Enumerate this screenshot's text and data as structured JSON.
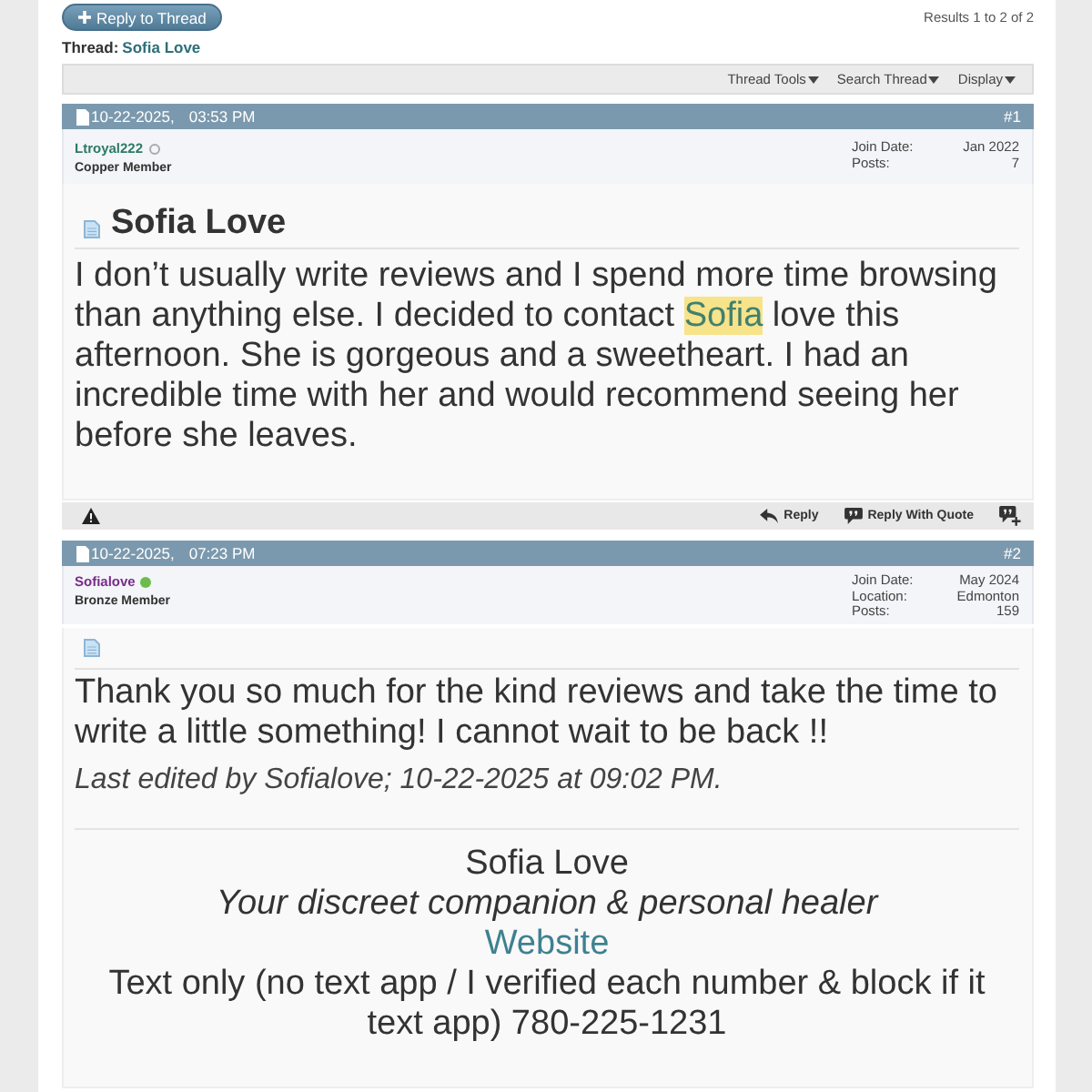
{
  "top_bar": {
    "reply_button": "Reply to Thread",
    "results": "Results 1 to 2 of 2"
  },
  "thread": {
    "label": "Thread:",
    "title": "Sofia Love"
  },
  "toolbar": {
    "menus": [
      "Thread Tools",
      "Search Thread",
      "Display"
    ]
  },
  "posts": [
    {
      "date": "10-22-2025,",
      "time": "03:53 PM",
      "number": "#1",
      "user": {
        "name": "Ltroyal222",
        "color": "#2e7a68",
        "online": false,
        "rank": "Copper Member",
        "details": [
          {
            "label": "Join Date:",
            "value": "Jan 2022"
          },
          {
            "label": "Posts:",
            "value": "7"
          }
        ]
      },
      "title": "Sofia Love",
      "message": [
        {
          "text": "I don’t usually write reviews and I spend more time browsing than anything else. I decided to contact ",
          "highlighted": false
        },
        {
          "text": "Sofia",
          "highlighted": true
        },
        {
          "text": " love this afternoon. She is gorgeous and a sweetheart. I had an incredible time with her and would recommend seeing her before she leaves.",
          "highlighted": false
        }
      ],
      "actions": [
        {
          "kind": "report"
        },
        {
          "kind": "reply",
          "label": "Reply"
        },
        {
          "kind": "quote",
          "label": "Reply With Quote"
        },
        {
          "kind": "multiquote"
        }
      ]
    },
    {
      "date": "10-22-2025,",
      "time": "07:23 PM",
      "number": "#2",
      "user": {
        "name": "Sofialove",
        "color": "#7a2a8c",
        "online": true,
        "rank": "Bronze Member",
        "details": [
          {
            "label": "Join Date:",
            "value": "May 2024"
          },
          {
            "label": "Location:",
            "value": "Edmonton"
          },
          {
            "label": "Posts:",
            "value": "159"
          }
        ]
      },
      "message": [
        {
          "text": "Thank you so much for the kind reviews and take the time to write a little something! I cannot wait to be back !!",
          "highlighted": false
        }
      ],
      "edit_note": "Last edited by Sofialove; 10-22-2025 at 09:02 PM.",
      "signature": [
        {
          "kind": "name",
          "text": "Sofia Love"
        },
        {
          "kind": "tagline",
          "text": "Your discreet companion & personal healer"
        },
        {
          "kind": "link",
          "text": "Website"
        },
        {
          "kind": "text",
          "text": "Text only (no text app / I verified each number & block if it text app) 780-225-1231"
        }
      ]
    }
  ]
}
